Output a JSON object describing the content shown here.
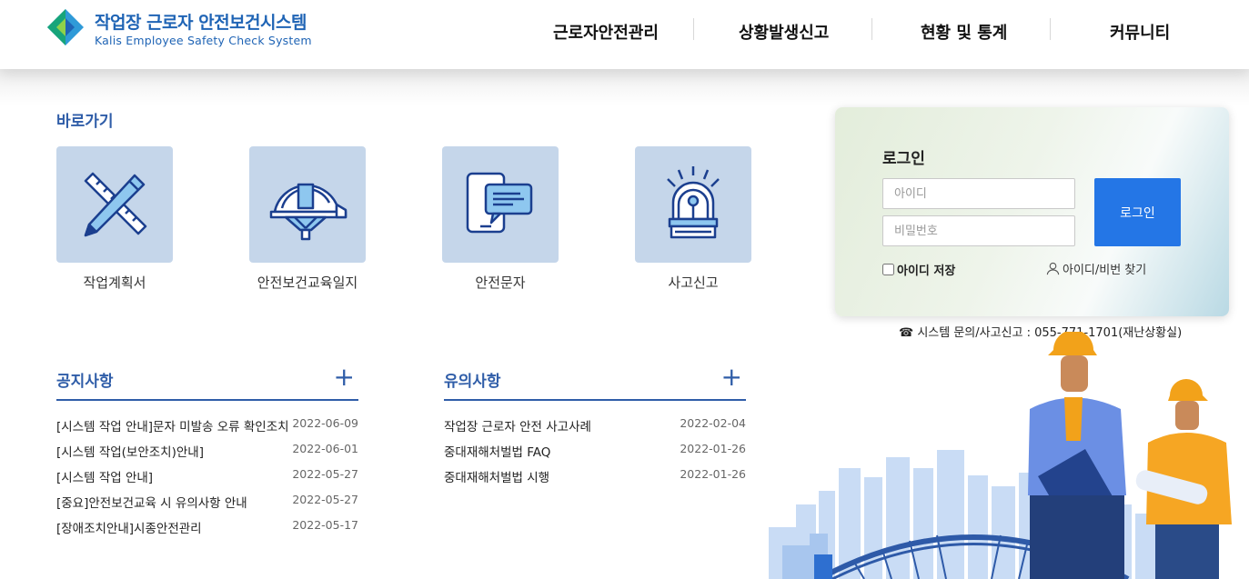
{
  "header": {
    "logo_title": "작업장 근로자 안전보건시스템",
    "logo_subtitle": "Kalis Employee Safety Check System",
    "nav": [
      {
        "label": "근로자안전관리"
      },
      {
        "label": "상황발생신고"
      },
      {
        "label": "현황 및 통계"
      },
      {
        "label": "커뮤니티"
      }
    ]
  },
  "shortcuts": {
    "title": "바로가기",
    "items": [
      {
        "label": "작업계획서",
        "icon": "ruler-pencil-icon"
      },
      {
        "label": "안전보건교육일지",
        "icon": "hard-hat-icon"
      },
      {
        "label": "안전문자",
        "icon": "phone-message-icon"
      },
      {
        "label": "사고신고",
        "icon": "siren-icon"
      }
    ]
  },
  "notices": {
    "title": "공지사항",
    "items": [
      {
        "title": "[시스템 작업 안내]문자 미발송 오류 확인조치",
        "date": "2022-06-09"
      },
      {
        "title": "[시스템 작업(보안조치)안내]",
        "date": "2022-06-01"
      },
      {
        "title": "[시스템 작업 안내]",
        "date": "2022-05-27"
      },
      {
        "title": "[중요]안전보건교육 시 유의사항 안내",
        "date": "2022-05-27"
      },
      {
        "title": "[장애조치안내]시종안전관리",
        "date": "2022-05-17"
      }
    ]
  },
  "cautions": {
    "title": "유의사항",
    "items": [
      {
        "title": "작업장 근로자 안전 사고사례",
        "date": "2022-02-04"
      },
      {
        "title": "중대재해처벌법 FAQ",
        "date": "2022-01-26"
      },
      {
        "title": "중대재해처벌법 시행",
        "date": "2022-01-26"
      }
    ]
  },
  "login": {
    "title": "로그인",
    "id_placeholder": "아이디",
    "pw_placeholder": "비밀번호",
    "button": "로그인",
    "save_id": "아이디 저장",
    "find": "아이디/비번 찾기"
  },
  "contact": "☎ 시스템 문의/사고신고 : 055-771-1701(재난상황실)",
  "colors": {
    "brand": "#1f64b5",
    "accent": "#2476e6",
    "tile": "#c5d6ea"
  }
}
